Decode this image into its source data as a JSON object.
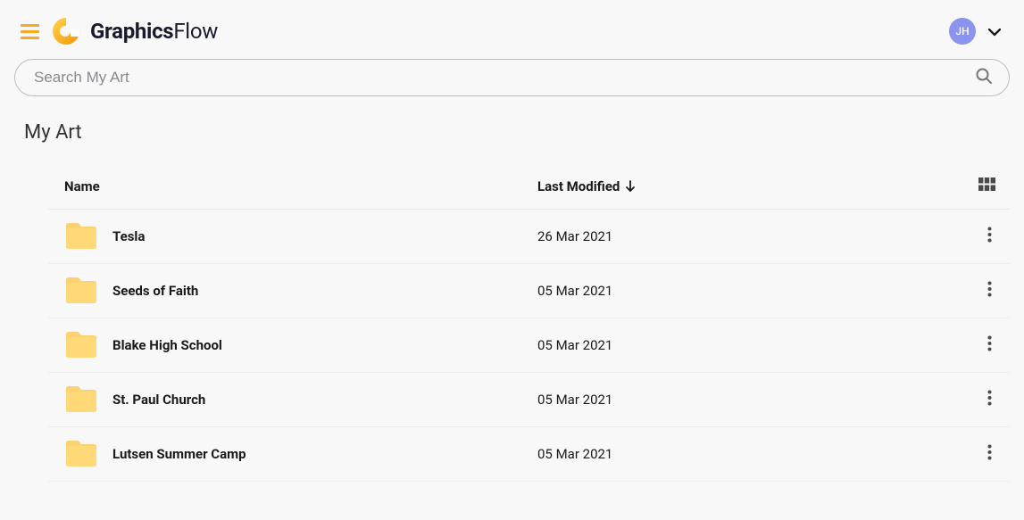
{
  "app": {
    "brand_bold": "Graphics",
    "brand_light": "Flow"
  },
  "user": {
    "initials": "JH"
  },
  "search": {
    "placeholder": "Search My Art"
  },
  "page": {
    "title": "My Art"
  },
  "table": {
    "columns": {
      "name": "Name",
      "modified": "Last Modified"
    },
    "rows": [
      {
        "name": "Tesla",
        "modified": "26 Mar 2021"
      },
      {
        "name": "Seeds of Faith",
        "modified": "05 Mar 2021"
      },
      {
        "name": "Blake High School",
        "modified": "05 Mar 2021"
      },
      {
        "name": "St. Paul Church",
        "modified": "05 Mar 2021"
      },
      {
        "name": "Lutsen Summer Camp",
        "modified": "05 Mar 2021"
      }
    ]
  }
}
